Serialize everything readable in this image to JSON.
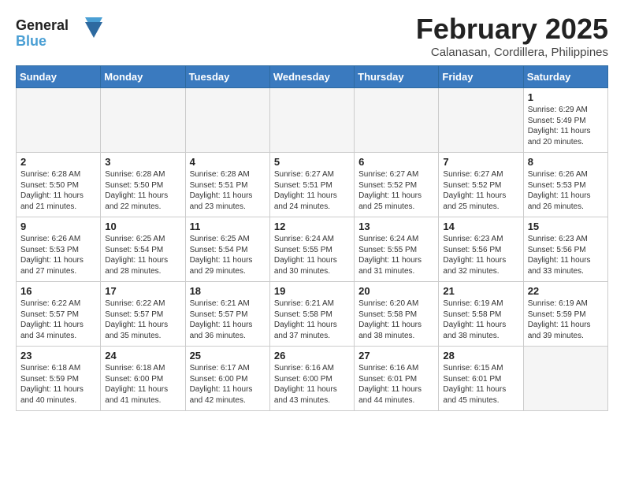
{
  "logo": {
    "line1": "General",
    "line2": "Blue"
  },
  "title": "February 2025",
  "subtitle": "Calanasan, Cordillera, Philippines",
  "days_of_week": [
    "Sunday",
    "Monday",
    "Tuesday",
    "Wednesday",
    "Thursday",
    "Friday",
    "Saturday"
  ],
  "weeks": [
    [
      {
        "day": "",
        "info": ""
      },
      {
        "day": "",
        "info": ""
      },
      {
        "day": "",
        "info": ""
      },
      {
        "day": "",
        "info": ""
      },
      {
        "day": "",
        "info": ""
      },
      {
        "day": "",
        "info": ""
      },
      {
        "day": "1",
        "info": "Sunrise: 6:29 AM\nSunset: 5:49 PM\nDaylight: 11 hours\nand 20 minutes."
      }
    ],
    [
      {
        "day": "2",
        "info": "Sunrise: 6:28 AM\nSunset: 5:50 PM\nDaylight: 11 hours\nand 21 minutes."
      },
      {
        "day": "3",
        "info": "Sunrise: 6:28 AM\nSunset: 5:50 PM\nDaylight: 11 hours\nand 22 minutes."
      },
      {
        "day": "4",
        "info": "Sunrise: 6:28 AM\nSunset: 5:51 PM\nDaylight: 11 hours\nand 23 minutes."
      },
      {
        "day": "5",
        "info": "Sunrise: 6:27 AM\nSunset: 5:51 PM\nDaylight: 11 hours\nand 24 minutes."
      },
      {
        "day": "6",
        "info": "Sunrise: 6:27 AM\nSunset: 5:52 PM\nDaylight: 11 hours\nand 25 minutes."
      },
      {
        "day": "7",
        "info": "Sunrise: 6:27 AM\nSunset: 5:52 PM\nDaylight: 11 hours\nand 25 minutes."
      },
      {
        "day": "8",
        "info": "Sunrise: 6:26 AM\nSunset: 5:53 PM\nDaylight: 11 hours\nand 26 minutes."
      }
    ],
    [
      {
        "day": "9",
        "info": "Sunrise: 6:26 AM\nSunset: 5:53 PM\nDaylight: 11 hours\nand 27 minutes."
      },
      {
        "day": "10",
        "info": "Sunrise: 6:25 AM\nSunset: 5:54 PM\nDaylight: 11 hours\nand 28 minutes."
      },
      {
        "day": "11",
        "info": "Sunrise: 6:25 AM\nSunset: 5:54 PM\nDaylight: 11 hours\nand 29 minutes."
      },
      {
        "day": "12",
        "info": "Sunrise: 6:24 AM\nSunset: 5:55 PM\nDaylight: 11 hours\nand 30 minutes."
      },
      {
        "day": "13",
        "info": "Sunrise: 6:24 AM\nSunset: 5:55 PM\nDaylight: 11 hours\nand 31 minutes."
      },
      {
        "day": "14",
        "info": "Sunrise: 6:23 AM\nSunset: 5:56 PM\nDaylight: 11 hours\nand 32 minutes."
      },
      {
        "day": "15",
        "info": "Sunrise: 6:23 AM\nSunset: 5:56 PM\nDaylight: 11 hours\nand 33 minutes."
      }
    ],
    [
      {
        "day": "16",
        "info": "Sunrise: 6:22 AM\nSunset: 5:57 PM\nDaylight: 11 hours\nand 34 minutes."
      },
      {
        "day": "17",
        "info": "Sunrise: 6:22 AM\nSunset: 5:57 PM\nDaylight: 11 hours\nand 35 minutes."
      },
      {
        "day": "18",
        "info": "Sunrise: 6:21 AM\nSunset: 5:57 PM\nDaylight: 11 hours\nand 36 minutes."
      },
      {
        "day": "19",
        "info": "Sunrise: 6:21 AM\nSunset: 5:58 PM\nDaylight: 11 hours\nand 37 minutes."
      },
      {
        "day": "20",
        "info": "Sunrise: 6:20 AM\nSunset: 5:58 PM\nDaylight: 11 hours\nand 38 minutes."
      },
      {
        "day": "21",
        "info": "Sunrise: 6:19 AM\nSunset: 5:58 PM\nDaylight: 11 hours\nand 38 minutes."
      },
      {
        "day": "22",
        "info": "Sunrise: 6:19 AM\nSunset: 5:59 PM\nDaylight: 11 hours\nand 39 minutes."
      }
    ],
    [
      {
        "day": "23",
        "info": "Sunrise: 6:18 AM\nSunset: 5:59 PM\nDaylight: 11 hours\nand 40 minutes."
      },
      {
        "day": "24",
        "info": "Sunrise: 6:18 AM\nSunset: 6:00 PM\nDaylight: 11 hours\nand 41 minutes."
      },
      {
        "day": "25",
        "info": "Sunrise: 6:17 AM\nSunset: 6:00 PM\nDaylight: 11 hours\nand 42 minutes."
      },
      {
        "day": "26",
        "info": "Sunrise: 6:16 AM\nSunset: 6:00 PM\nDaylight: 11 hours\nand 43 minutes."
      },
      {
        "day": "27",
        "info": "Sunrise: 6:16 AM\nSunset: 6:01 PM\nDaylight: 11 hours\nand 44 minutes."
      },
      {
        "day": "28",
        "info": "Sunrise: 6:15 AM\nSunset: 6:01 PM\nDaylight: 11 hours\nand 45 minutes."
      },
      {
        "day": "",
        "info": ""
      }
    ]
  ]
}
